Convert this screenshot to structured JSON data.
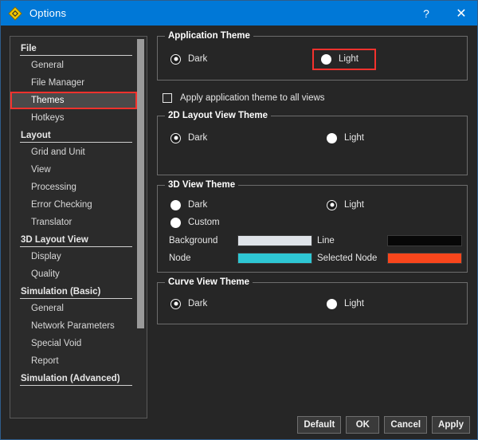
{
  "window": {
    "title": "Options",
    "icon": "diamond-app-icon",
    "help_label": "?",
    "close_label": "✕"
  },
  "sidebar": {
    "nodes": [
      {
        "type": "group",
        "label": "File"
      },
      {
        "type": "item",
        "label": "General",
        "selected": false
      },
      {
        "type": "item",
        "label": "File Manager",
        "selected": false
      },
      {
        "type": "item",
        "label": "Themes",
        "selected": true
      },
      {
        "type": "item",
        "label": "Hotkeys",
        "selected": false
      },
      {
        "type": "group",
        "label": "Layout"
      },
      {
        "type": "item",
        "label": "Grid and Unit",
        "selected": false
      },
      {
        "type": "item",
        "label": "View",
        "selected": false
      },
      {
        "type": "item",
        "label": "Processing",
        "selected": false
      },
      {
        "type": "item",
        "label": "Error Checking",
        "selected": false
      },
      {
        "type": "item",
        "label": "Translator",
        "selected": false
      },
      {
        "type": "group",
        "label": "3D Layout View"
      },
      {
        "type": "item",
        "label": "Display",
        "selected": false
      },
      {
        "type": "item",
        "label": "Quality",
        "selected": false
      },
      {
        "type": "group",
        "label": "Simulation (Basic)"
      },
      {
        "type": "item",
        "label": "General",
        "selected": false
      },
      {
        "type": "item",
        "label": "Network Parameters",
        "selected": false
      },
      {
        "type": "item",
        "label": "Special Void",
        "selected": false
      },
      {
        "type": "item",
        "label": "Report",
        "selected": false
      },
      {
        "type": "group",
        "label": "Simulation (Advanced)"
      }
    ]
  },
  "application_theme": {
    "group_label": "Application Theme",
    "dark_label": "Dark",
    "light_label": "Light",
    "selected": "Dark",
    "light_highlighted": true,
    "highlight_color": "#f4322d"
  },
  "apply_all_views": {
    "label": "Apply application theme to all views",
    "checked": false
  },
  "layout2d_theme": {
    "group_label": "2D Layout View Theme",
    "dark_label": "Dark",
    "light_label": "Light",
    "selected": "Dark"
  },
  "view3d_theme": {
    "group_label": "3D View Theme",
    "dark_label": "Dark",
    "light_label": "Light",
    "custom_label": "Custom",
    "selected": "Light",
    "colors": [
      {
        "label": "Background",
        "value": "#dfe3e8"
      },
      {
        "label": "Line",
        "value": "#070707"
      },
      {
        "label": "Node",
        "value": "#2ec7d4"
      },
      {
        "label": "Selected Node",
        "value": "#f9461c"
      }
    ]
  },
  "curve_theme": {
    "group_label": "Curve View Theme",
    "dark_label": "Dark",
    "light_label": "Light",
    "selected": "Dark"
  },
  "footer": {
    "default_label": "Default",
    "ok_label": "OK",
    "cancel_label": "Cancel",
    "apply_label": "Apply"
  }
}
